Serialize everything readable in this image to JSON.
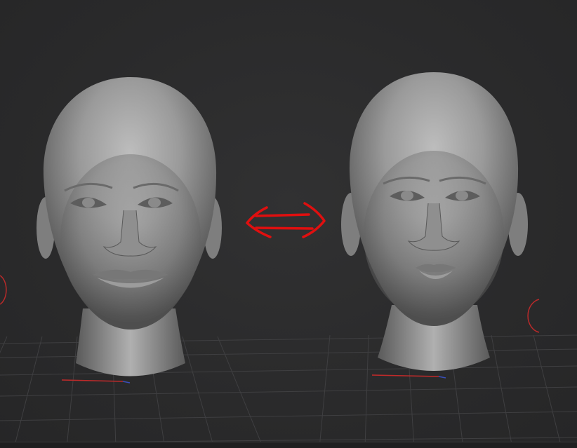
{
  "viewport": {
    "background_color": "#2b2b2c",
    "grid_color": "#3f3f41",
    "axis_x_color": "#c02a2a",
    "axis_z_color": "#3a4fb8"
  },
  "models": [
    {
      "name": "head-model-left",
      "description_icon": "sculpted-female-head"
    },
    {
      "name": "head-model-right",
      "description_icon": "sculpted-female-head"
    }
  ],
  "annotation": {
    "icon": "double-arrow-icon",
    "stroke_color": "#e00f0f"
  },
  "gizmos": [
    {
      "icon": "rotation-gizmo-arc-icon",
      "color": "#b82a2a"
    },
    {
      "icon": "rotation-gizmo-arc-icon",
      "color": "#b82a2a"
    }
  ]
}
